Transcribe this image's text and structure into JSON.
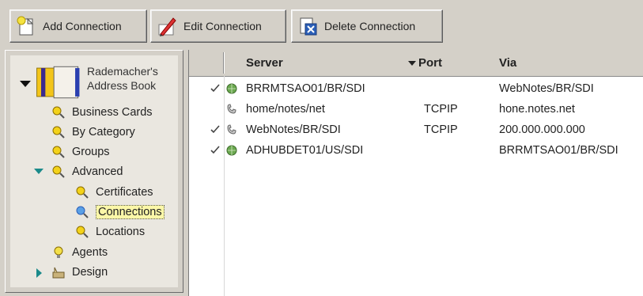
{
  "toolbar": {
    "add_label": "Add Connection",
    "edit_label": "Edit Connection",
    "delete_label": "Delete Connection"
  },
  "sidebar": {
    "title_line1": "Rademacher's",
    "title_line2": "Address Book",
    "items": [
      {
        "label": "Business Cards"
      },
      {
        "label": "By Category"
      },
      {
        "label": "Groups"
      },
      {
        "label": "Advanced"
      },
      {
        "label": "Certificates"
      },
      {
        "label": "Connections"
      },
      {
        "label": "Locations"
      },
      {
        "label": "Agents"
      },
      {
        "label": "Design"
      }
    ]
  },
  "table": {
    "columns": {
      "server": "Server",
      "port": "Port",
      "via": "Via"
    },
    "rows": [
      {
        "server": "BRRMTSAO01/BR/SDI",
        "port": "",
        "via": "WebNotes/BR/SDI",
        "checked": true,
        "icon": "globe-icon"
      },
      {
        "server": "home/notes/net",
        "port": "TCPIP",
        "via": "hone.notes.net",
        "checked": false,
        "icon": "phone-icon"
      },
      {
        "server": "WebNotes/BR/SDI",
        "port": "TCPIP",
        "via": "200.000.000.000",
        "checked": true,
        "icon": "phone-icon"
      },
      {
        "server": "ADHUBDET01/US/SDI",
        "port": "",
        "via": "BRRMTSAO01/BR/SDI",
        "checked": true,
        "icon": "globe-icon"
      }
    ]
  },
  "colors": {
    "window_bg": "#d4d0c8",
    "tree_arrow": "#1a8a8a",
    "selection_bg": "#fbf7a8"
  }
}
